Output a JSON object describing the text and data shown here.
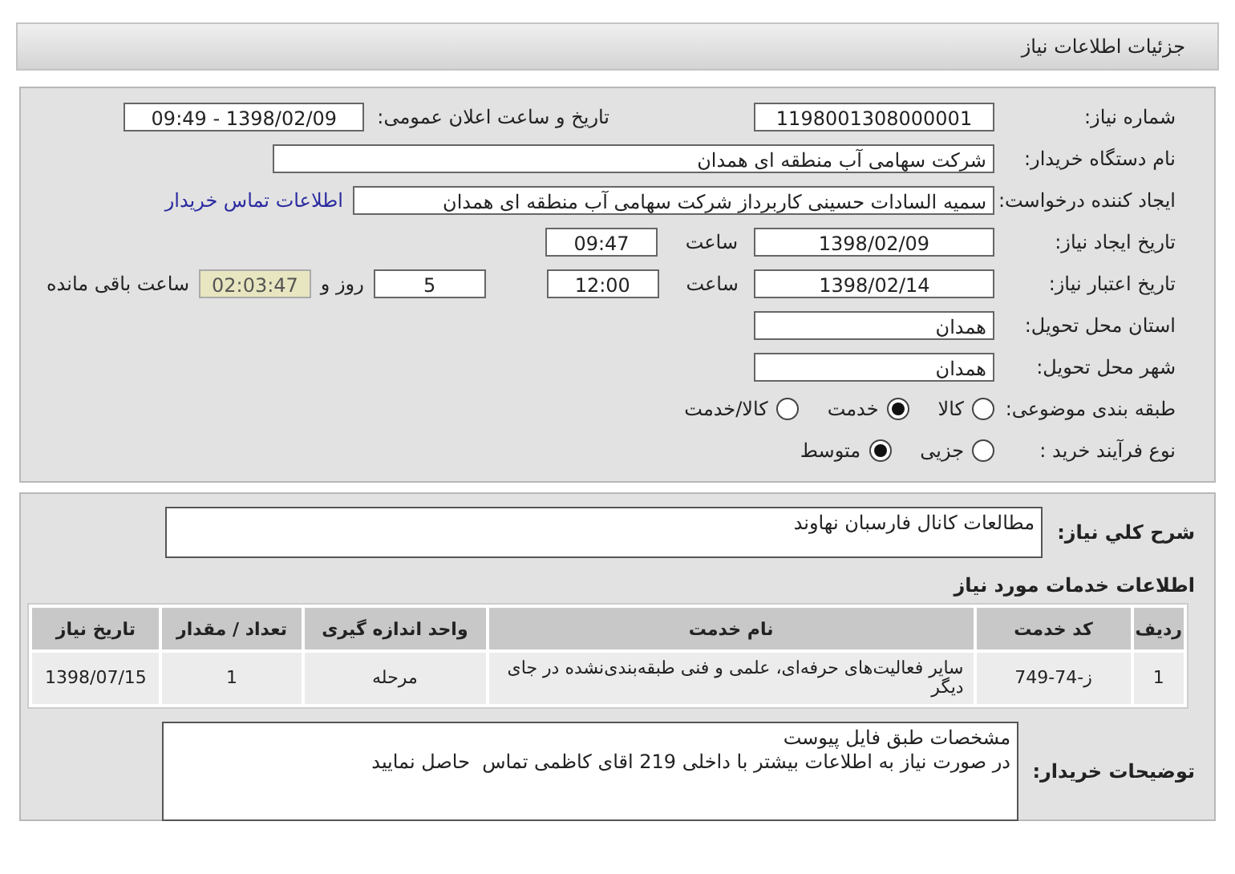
{
  "header": {
    "title": "جزئیات اطلاعات نیاز"
  },
  "details": {
    "need_number": {
      "label": "شماره نیاز:",
      "value": "1198001308000001"
    },
    "announce": {
      "label": "تاریخ و ساعت اعلان عمومی:",
      "value": "1398/02/09 - 09:49"
    },
    "buyer_org": {
      "label": "نام دستگاه خریدار:",
      "value": "شرکت سهامی آب منطقه ای همدان"
    },
    "requester": {
      "label": "ایجاد کننده درخواست:",
      "value": "سمیه السادات حسینی کاربرداز شرکت سهامی آب منطقه ای همدان",
      "link": "اطلاعات تماس خریدار"
    },
    "created": {
      "label": "تاریخ ایجاد نیاز:",
      "date": "1398/02/09",
      "time_label": "ساعت",
      "time": "09:47"
    },
    "validity": {
      "label": "تاریخ اعتبار نیاز:",
      "date": "1398/02/14",
      "time_label": "ساعت",
      "time": "12:00",
      "days": "5",
      "days_label": "روز و",
      "remaining": "02:03:47",
      "remaining_label": "ساعت باقی مانده"
    },
    "province": {
      "label": "استان محل تحویل:",
      "value": "همدان"
    },
    "city": {
      "label": "شهر محل تحویل:",
      "value": "همدان"
    },
    "category": {
      "label": "طبقه بندی موضوعی:",
      "options": [
        {
          "label": "کالا",
          "selected": false
        },
        {
          "label": "خدمت",
          "selected": true
        },
        {
          "label": "کالا/خدمت",
          "selected": false
        }
      ]
    },
    "process": {
      "label": "نوع فرآیند خرید :",
      "options": [
        {
          "label": "جزیی",
          "selected": false
        },
        {
          "label": "متوسط",
          "selected": true
        }
      ]
    }
  },
  "summary": {
    "label": "شرح کلي نياز:",
    "value": "مطالعات کانال فارسبان نهاوند"
  },
  "services": {
    "title": "اطلاعات خدمات مورد نیاز",
    "columns": [
      "ردیف",
      "کد خدمت",
      "نام خدمت",
      "واحد اندازه گیری",
      "تعداد / مقدار",
      "تاریخ نیاز"
    ],
    "rows": [
      [
        "1",
        "ز-74-749",
        "سایر فعالیت‌های حرفه‌ای، علمی و فنی طبقه‌بندی‌نشده در جای دیگر",
        "مرحله",
        "1",
        "1398/07/15"
      ]
    ]
  },
  "notes": {
    "label": "توضیحات خریدار:",
    "lines": [
      "مشخصات طبق فایل پیوست",
      "در صورت نیاز به اطلاعات بیشتر با داخلی 219 اقای کاظمی تماس  حاصل نمایید"
    ]
  }
}
